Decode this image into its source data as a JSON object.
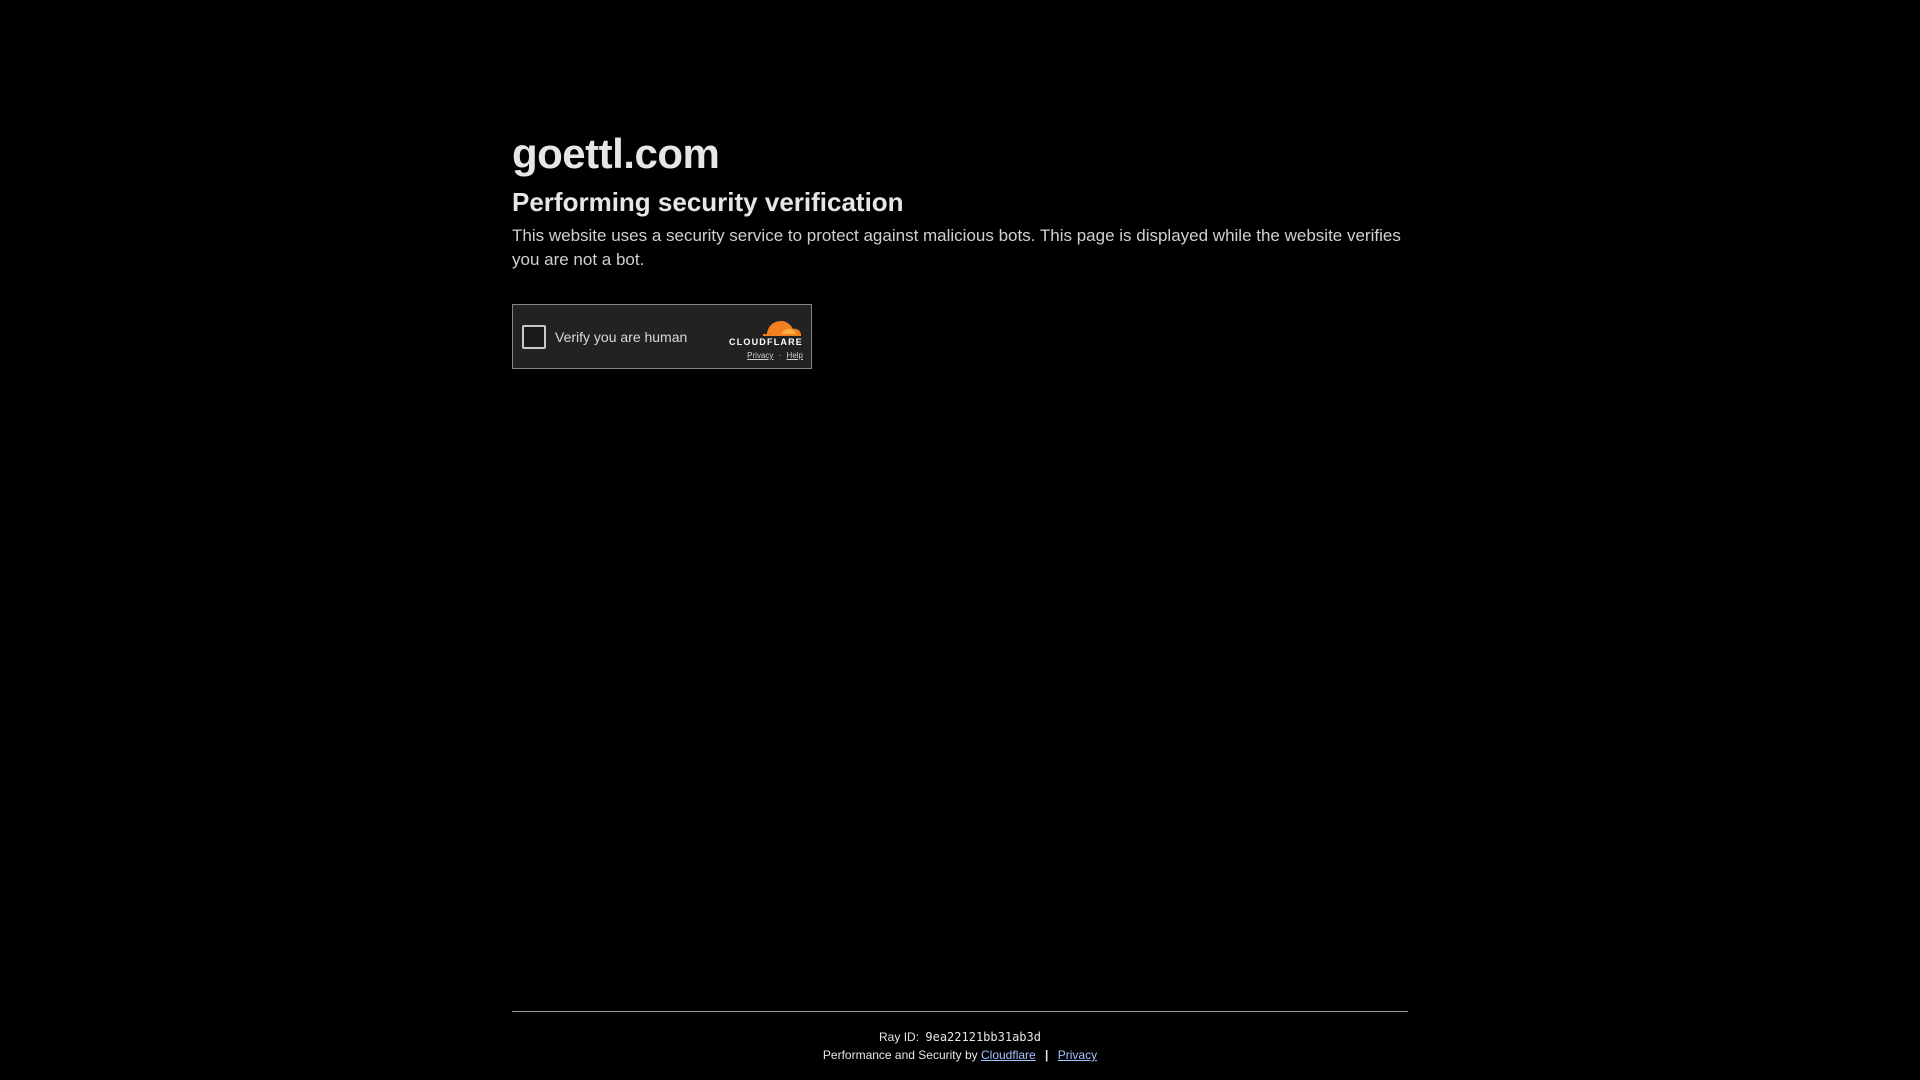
{
  "site": {
    "domain": "goettl.com"
  },
  "main": {
    "heading": "Performing security verification",
    "description": "This website uses a security service to protect against malicious bots. This page is displayed while the website verifies you are not a bot."
  },
  "widget": {
    "checkbox_label": "Verify you are human",
    "brand": "CLOUDFLARE",
    "privacy_link": "Privacy",
    "separator": "·",
    "help_link": "Help",
    "brand_color": "#f38020"
  },
  "footer": {
    "ray_label": "Ray ID:",
    "ray_id": "9ea22121bb31ab3d",
    "perf_text": "Performance and Security by",
    "cloudflare_link": "Cloudflare",
    "separator": "|",
    "privacy_link": "Privacy"
  }
}
